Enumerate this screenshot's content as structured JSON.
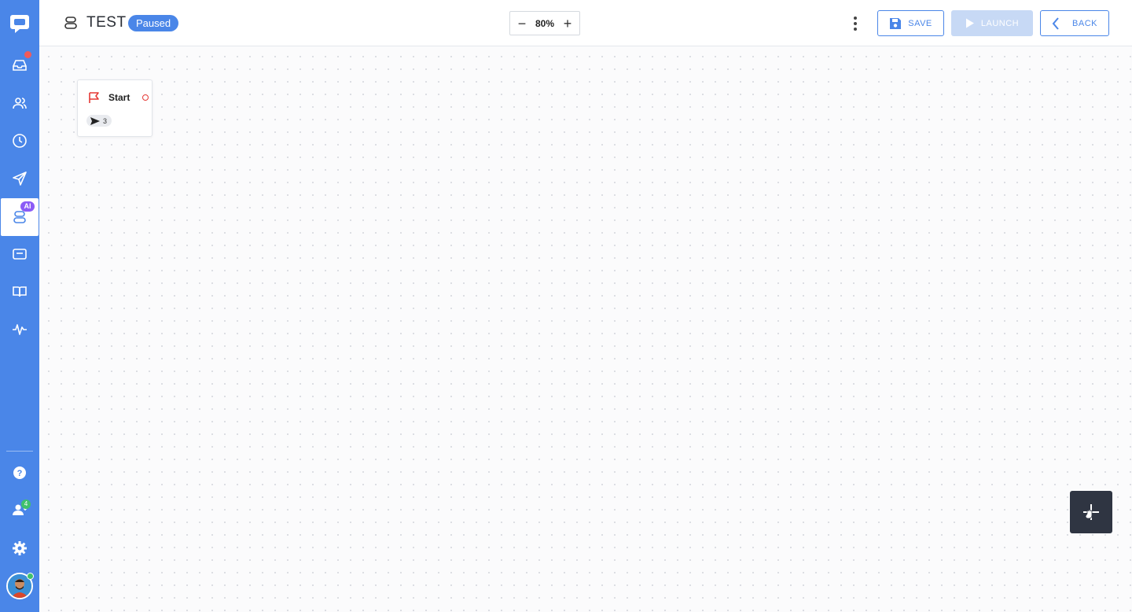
{
  "header": {
    "title": "TEST",
    "status": "Paused",
    "zoom": {
      "value": "80%",
      "minus": "−",
      "plus": "+"
    },
    "save_label": "SAVE",
    "launch_label": "LAUNCH",
    "back_label": "BACK"
  },
  "sidebar": {
    "items": [
      {
        "icon": "inbox-icon",
        "has_notification": true
      },
      {
        "icon": "contacts-icon"
      },
      {
        "icon": "clock-icon"
      },
      {
        "icon": "send-icon"
      },
      {
        "icon": "bot-icon",
        "active": true,
        "badge": "AI"
      },
      {
        "icon": "wallet-icon"
      },
      {
        "icon": "book-icon"
      },
      {
        "icon": "activity-icon"
      }
    ],
    "bottom": [
      {
        "icon": "help-icon"
      },
      {
        "icon": "team-icon",
        "badge": "4"
      },
      {
        "icon": "gear-icon"
      },
      {
        "icon": "avatar"
      }
    ]
  },
  "canvas": {
    "start_node": {
      "title": "Start",
      "sent_count": "3"
    }
  },
  "colors": {
    "brand": "#4a86e8",
    "ai_badge": "#8b5cf6",
    "alert": "#e53935",
    "online": "#3fc16b",
    "fab": "#2f3542"
  }
}
